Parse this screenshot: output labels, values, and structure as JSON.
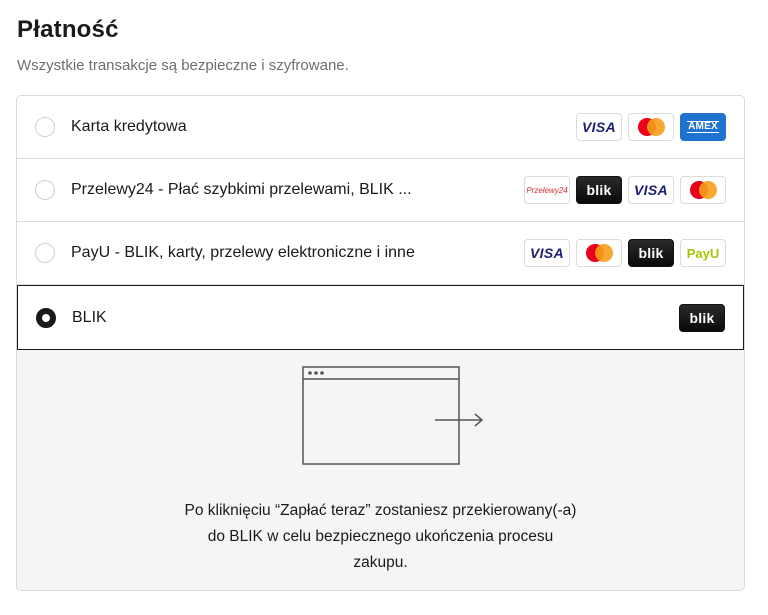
{
  "header": {
    "title": "Płatność",
    "subtitle": "Wszystkie transakcje są bezpieczne i szyfrowane."
  },
  "payment_methods": [
    {
      "label": "Karta kredytowa",
      "selected": false,
      "logos": [
        "VISA",
        "mastercard",
        "AMEX"
      ]
    },
    {
      "label": "Przelewy24 - Płać szybkimi przelewami, BLIK ...",
      "selected": false,
      "logos": [
        "Przelewy24",
        "blik",
        "VISA",
        "mastercard"
      ]
    },
    {
      "label": "PayU - BLIK, karty, przelewy elektroniczne i inne",
      "selected": false,
      "logos": [
        "VISA",
        "mastercard",
        "blik",
        "PayU"
      ]
    },
    {
      "label": "BLIK",
      "selected": true,
      "logos": [
        "blik"
      ]
    }
  ],
  "logo_text": {
    "visa": "VISA",
    "amex": "AMEX",
    "blik": "blik",
    "payu": "PayU",
    "p24": "Przelewy24"
  },
  "selected_details": {
    "info_line1": "Po kliknięciu “Zapłać teraz” zostaniesz przekierowany(-a)",
    "info_line2": "do BLIK w celu bezpiecznego ukończenia procesu",
    "info_line3": "zakupu."
  },
  "colors": {
    "text": "#1a1a1a",
    "muted": "#6e6e6e",
    "details_bg": "#f5f5f5",
    "amex": "#1f72cd",
    "visa": "#1a1f71",
    "mc_red": "#eb001b",
    "mc_orange": "#f79e1b"
  }
}
